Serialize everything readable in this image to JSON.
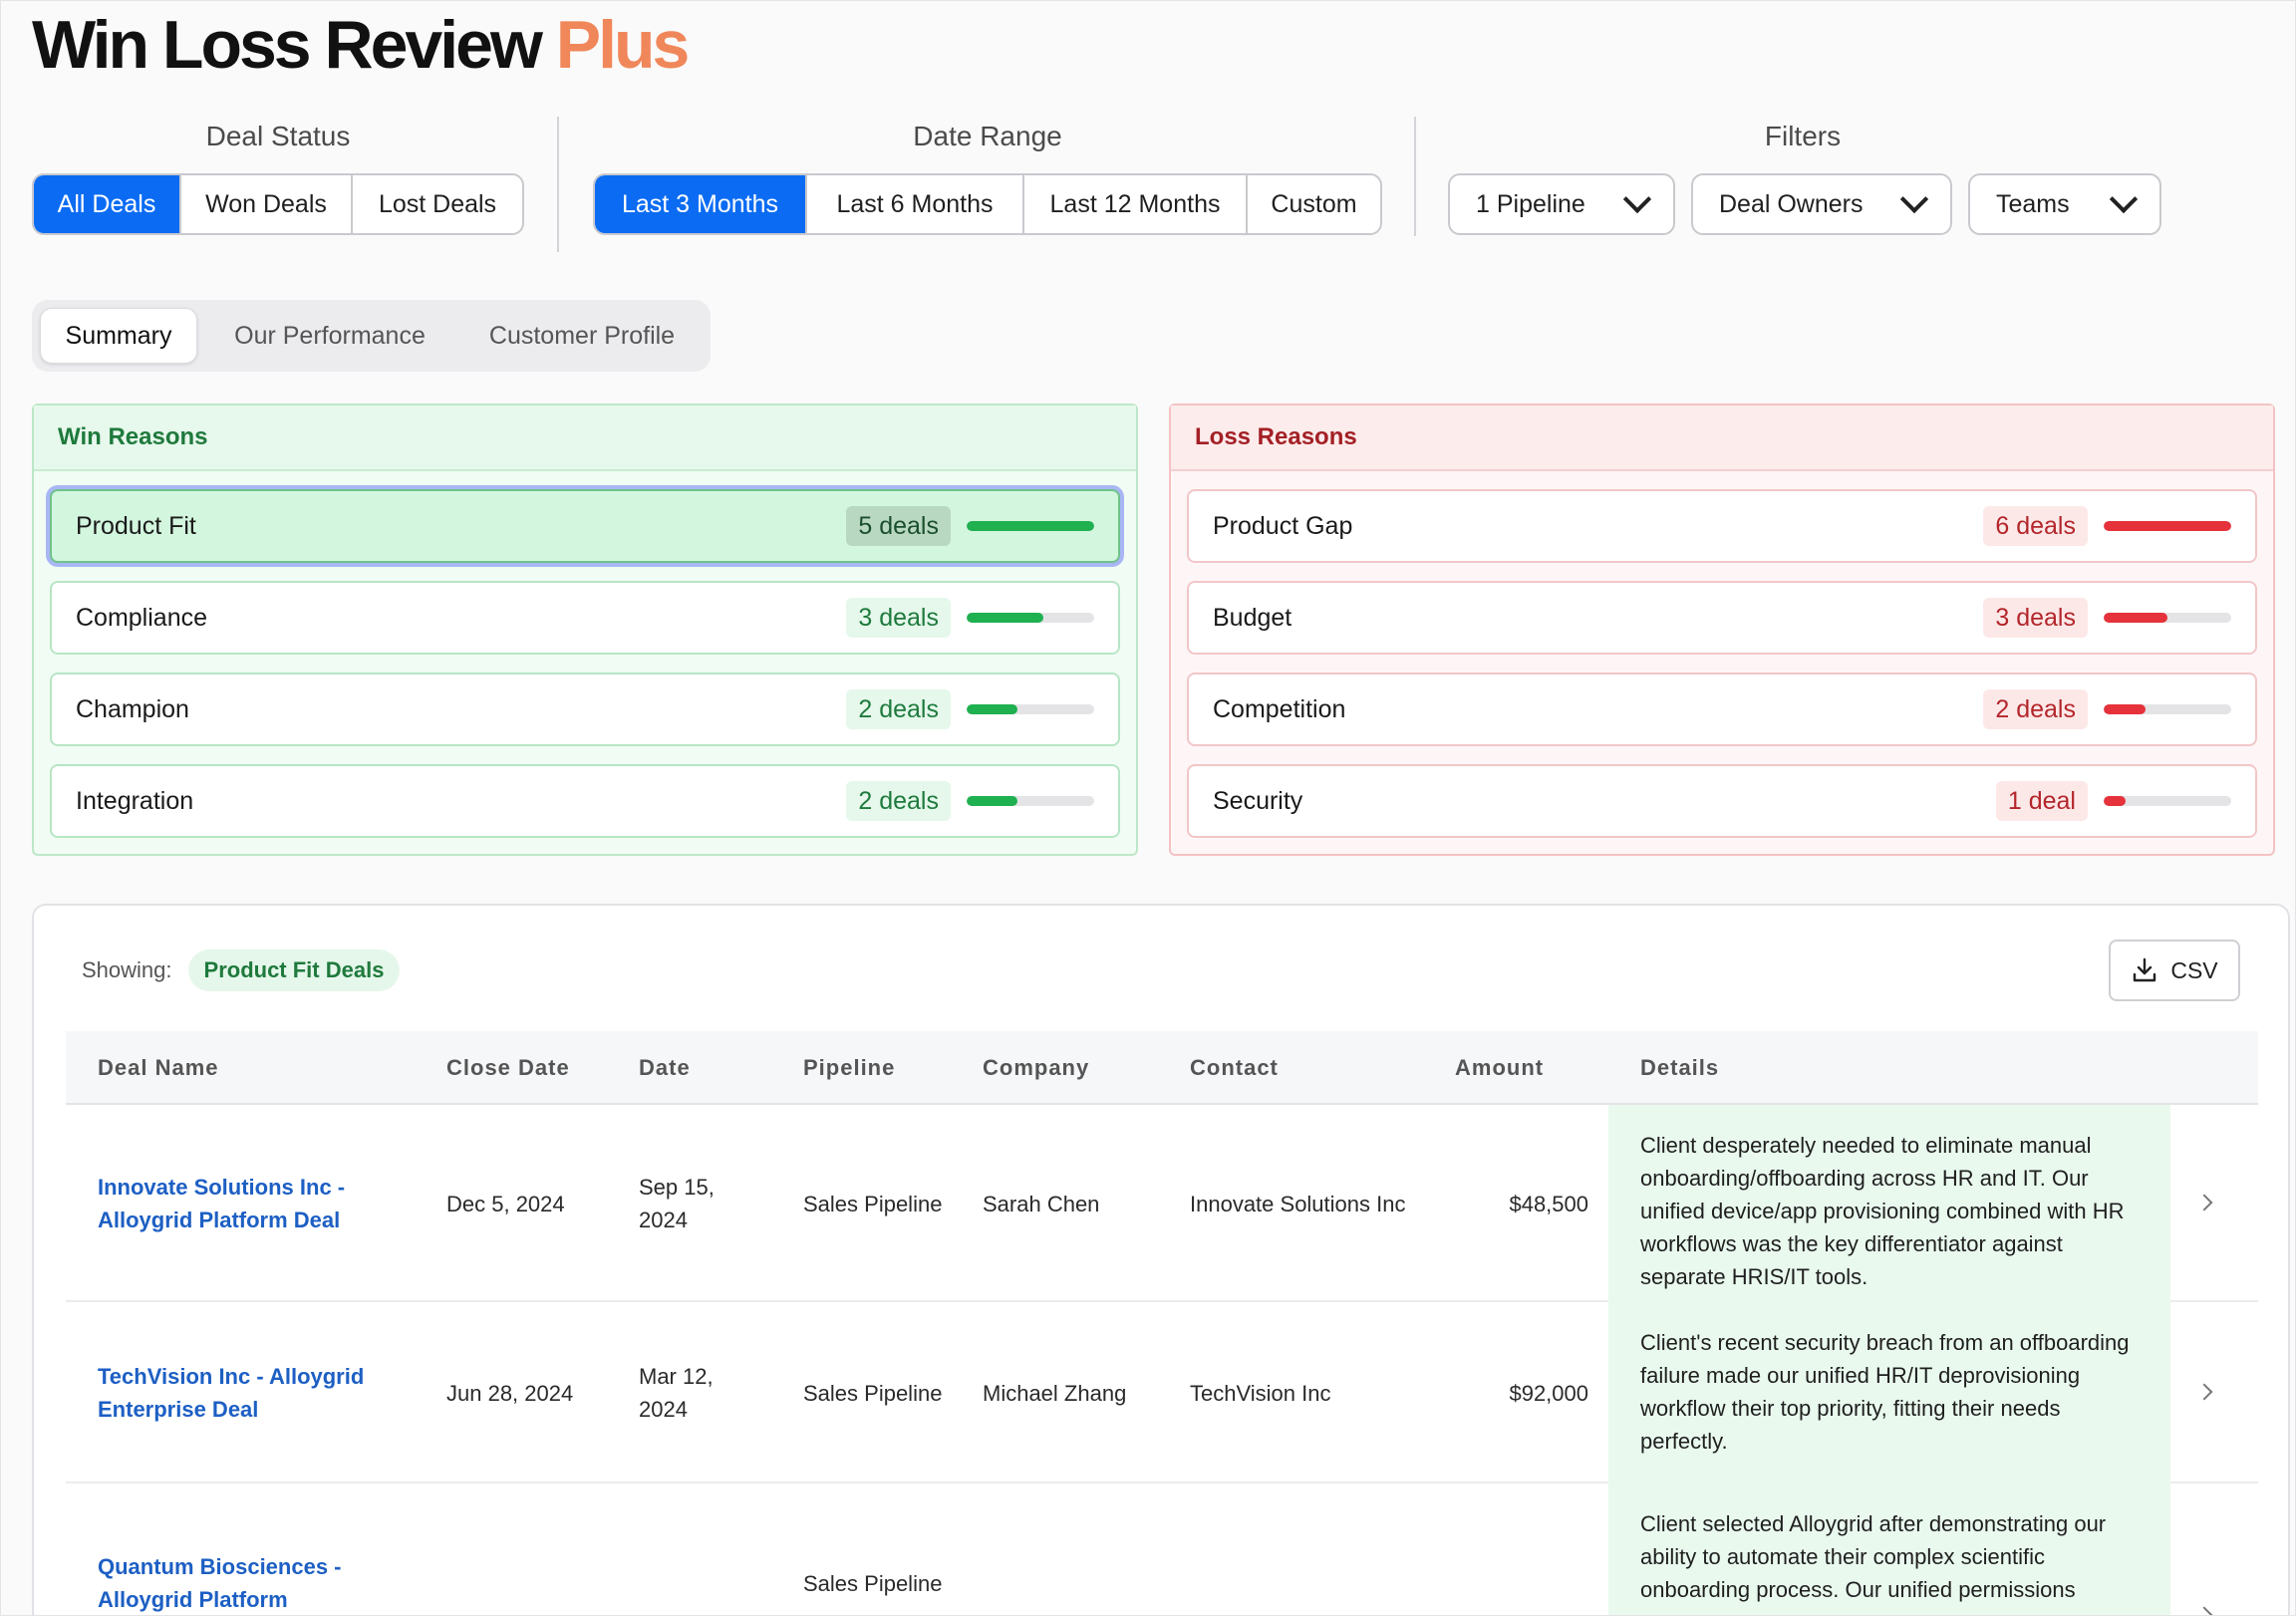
{
  "app": {
    "title_main": "Win Loss Review",
    "title_accent": "Plus"
  },
  "deal_status": {
    "label": "Deal Status",
    "options": [
      "All Deals",
      "Won Deals",
      "Lost Deals"
    ],
    "selected": "All Deals"
  },
  "date_range": {
    "label": "Date Range",
    "options": [
      "Last 3 Months",
      "Last 6 Months",
      "Last 12 Months",
      "Custom"
    ],
    "selected": "Last 3 Months"
  },
  "filters": {
    "label": "Filters",
    "pipeline": "1 Pipeline",
    "owners": "Deal Owners",
    "teams": "Teams"
  },
  "tabs": [
    "Summary",
    "Our Performance",
    "Customer Profile"
  ],
  "active_tab": "Summary",
  "win_reasons": {
    "title": "Win Reasons",
    "items": [
      {
        "label": "Product Fit",
        "count_label": "5 deals",
        "fraction": 1.0
      },
      {
        "label": "Compliance",
        "count_label": "3 deals",
        "fraction": 0.6
      },
      {
        "label": "Champion",
        "count_label": "2 deals",
        "fraction": 0.4
      },
      {
        "label": "Integration",
        "count_label": "2 deals",
        "fraction": 0.4
      }
    ]
  },
  "loss_reasons": {
    "title": "Loss Reasons",
    "items": [
      {
        "label": "Product Gap",
        "count_label": "6 deals",
        "fraction": 1.0
      },
      {
        "label": "Budget",
        "count_label": "3 deals",
        "fraction": 0.5
      },
      {
        "label": "Competition",
        "count_label": "2 deals",
        "fraction": 0.33
      },
      {
        "label": "Security",
        "count_label": "1 deal",
        "fraction": 0.17
      }
    ]
  },
  "table": {
    "showing_label": "Showing:",
    "showing_value": "Product Fit Deals",
    "csv_label": "CSV",
    "columns": [
      "Deal Name",
      "Close Date",
      "Date",
      "Pipeline",
      "Company",
      "Contact",
      "Amount",
      "Details"
    ],
    "rows": [
      {
        "deal_name": "Innovate Solutions Inc - Alloygrid Platform Deal",
        "close_date": "Dec 5, 2024",
        "date": "Sep 15, 2024",
        "pipeline": "Sales Pipeline",
        "company": "Sarah Chen",
        "contact": "Innovate Solutions Inc",
        "amount": "$48,500",
        "details": "Client desperately needed to eliminate manual onboarding/offboarding across HR and IT. Our unified device/app provisioning combined with HR workflows was the key differentiator against separate HRIS/IT tools."
      },
      {
        "deal_name": "TechVision Inc - Alloygrid Enterprise Deal",
        "close_date": "Jun 28, 2024",
        "date": "Mar 12, 2024",
        "pipeline": "Sales Pipeline",
        "company": "Michael Zhang",
        "contact": "TechVision Inc",
        "amount": "$92,000",
        "details": "Client's recent security breach from an offboarding failure made our unified HR/IT deprovisioning workflow their top priority, fitting their needs perfectly."
      },
      {
        "deal_name": "Quantum Biosciences - Alloygrid Platform",
        "close_date": "",
        "date": "",
        "pipeline": "Sales Pipeline",
        "company": "",
        "contact": "",
        "amount": "",
        "details": "Client selected Alloygrid after demonstrating our ability to automate their complex scientific onboarding process. Our unified permissions"
      }
    ]
  }
}
